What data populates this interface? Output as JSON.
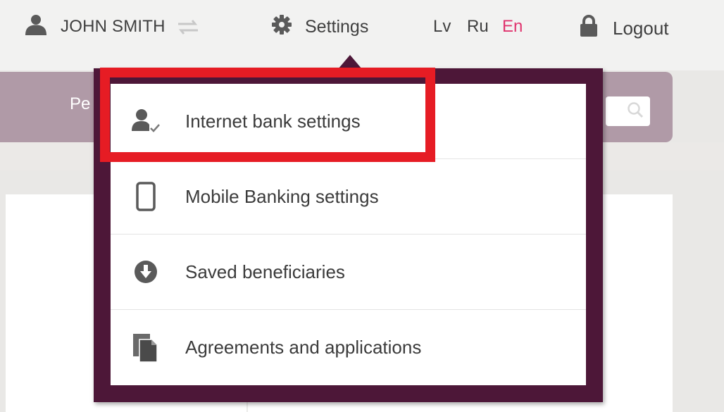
{
  "topbar": {
    "user_name": "JOHN SMITH",
    "settings_label": "Settings",
    "languages": [
      {
        "code": "Lv",
        "active": false
      },
      {
        "code": "Ru",
        "active": false
      },
      {
        "code": "En",
        "active": true
      }
    ],
    "logout_label": "Logout"
  },
  "nav": {
    "partial_label": "Pe"
  },
  "dropdown": {
    "items": [
      {
        "label": "Internet bank settings",
        "icon": "user-check-icon",
        "highlighted": true
      },
      {
        "label": "Mobile Banking settings",
        "icon": "mobile-phone-icon",
        "highlighted": false
      },
      {
        "label": "Saved beneficiaries",
        "icon": "download-circle-icon",
        "highlighted": false
      },
      {
        "label": "Agreements and applications",
        "icon": "documents-icon",
        "highlighted": false
      }
    ]
  },
  "colors": {
    "dropdown_frame": "#4d1738",
    "nav_band": "#b09aa7",
    "active_language": "#e0356f",
    "highlight_box": "#e61c24"
  }
}
